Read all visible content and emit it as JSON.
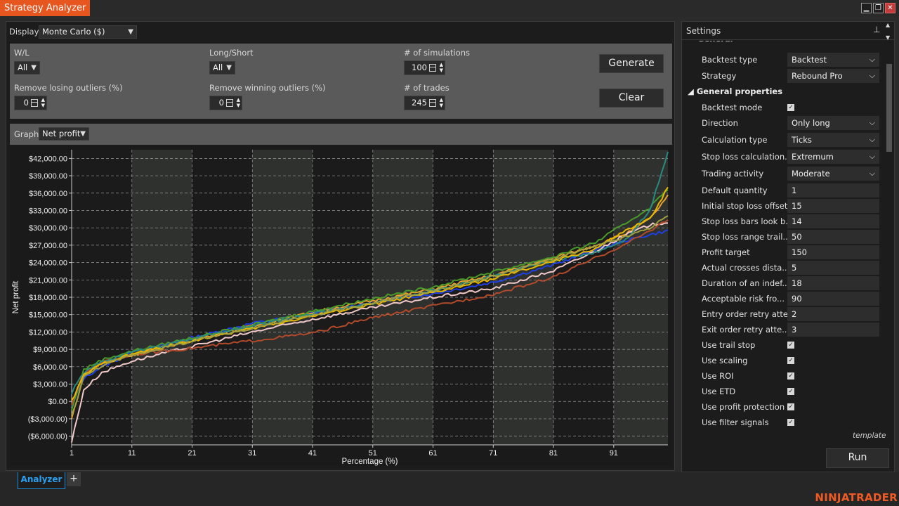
{
  "window": {
    "title": "Strategy Analyzer"
  },
  "toolbar": {
    "display_label": "Display",
    "display_value": "Monte Carlo ($)"
  },
  "filters": {
    "wl_label": "W/L",
    "wl_value": "All",
    "longshort_label": "Long/Short",
    "longshort_value": "All",
    "sims_label": "# of simulations",
    "sims_value": "100",
    "remove_losing_label": "Remove losing outliers (%)",
    "remove_losing_value": "0",
    "remove_winning_label": "Remove winning outliers (%)",
    "remove_winning_value": "0",
    "trades_label": "# of trades",
    "trades_value": "245",
    "generate_label": "Generate",
    "clear_label": "Clear"
  },
  "graph": {
    "label": "Graph",
    "value": "Net profit"
  },
  "chart_data": {
    "type": "line",
    "xlabel": "Percentage (%)",
    "ylabel": "Net profit",
    "xlim": [
      1,
      100
    ],
    "ylim": [
      -7500,
      43500
    ],
    "x_ticks": [
      "1",
      "11",
      "21",
      "31",
      "41",
      "51",
      "61",
      "71",
      "81",
      "91"
    ],
    "y_ticks": [
      "$42,000.00",
      "$39,000.00",
      "$36,000.00",
      "$33,000.00",
      "$30,000.00",
      "$27,000.00",
      "$24,000.00",
      "$21,000.00",
      "$18,000.00",
      "$15,000.00",
      "$12,000.00",
      "$9,000.00",
      "$6,000.00",
      "$3,000.00",
      "$0.00",
      "($3,000.00)",
      "($6,000.00)"
    ],
    "y_tick_values": [
      42000,
      39000,
      36000,
      33000,
      30000,
      27000,
      24000,
      21000,
      18000,
      15000,
      12000,
      9000,
      6000,
      3000,
      0,
      -3000,
      -6000
    ],
    "grid": true,
    "typical_curve": {
      "x": [
        1,
        3,
        6,
        11,
        21,
        31,
        41,
        51,
        61,
        71,
        81,
        88,
        93,
        97,
        100
      ],
      "values": [
        -2000,
        4500,
        6500,
        8000,
        10500,
        12800,
        15000,
        17000,
        19000,
        21500,
        24500,
        26500,
        28500,
        31000,
        34000
      ]
    },
    "series": [
      {
        "color": "#1f3fe0",
        "values": [
          -1000,
          4000,
          6000,
          8300,
          11000,
          13500,
          15200,
          17200,
          18600,
          20600,
          23600,
          26200,
          27800,
          28800,
          29500
        ]
      },
      {
        "color": "#e8a030",
        "values": [
          -3000,
          4500,
          6600,
          8000,
          10600,
          13000,
          15400,
          17400,
          19400,
          21800,
          24800,
          27000,
          29000,
          31500,
          35500
        ]
      },
      {
        "color": "#4a9a2a",
        "values": [
          -1500,
          5500,
          7200,
          8700,
          11000,
          13200,
          15600,
          17800,
          19800,
          22400,
          25000,
          27500,
          30800,
          33500,
          36800
        ]
      },
      {
        "color": "#f0c8c8",
        "values": [
          -7000,
          2000,
          5000,
          7000,
          9500,
          12000,
          14200,
          16200,
          18000,
          19500,
          22600,
          26000,
          28800,
          30500,
          31000
        ]
      },
      {
        "color": "#b04a2a",
        "values": [
          -500,
          4800,
          6800,
          8100,
          9200,
          10500,
          11800,
          14500,
          16500,
          18500,
          21500,
          24800,
          27200,
          29500,
          31500
        ]
      },
      {
        "color": "#2a8a80",
        "values": [
          1500,
          5000,
          6800,
          8500,
          10800,
          13000,
          15200,
          17000,
          19200,
          21700,
          24300,
          25800,
          28000,
          33000,
          43200
        ]
      },
      {
        "color": "#e8b800",
        "values": [
          0,
          4500,
          6500,
          8200,
          10500,
          12600,
          14800,
          16800,
          18800,
          21200,
          24200,
          26400,
          29500,
          31500,
          37000
        ]
      },
      {
        "color": "#a0a040",
        "values": [
          -2500,
          4200,
          6200,
          8000,
          10400,
          12700,
          14900,
          17000,
          19100,
          21600,
          24600,
          26800,
          28400,
          30000,
          32000
        ]
      }
    ]
  },
  "settings": {
    "title": "Settings",
    "truncated_section": "General",
    "section_general_props": "General properties",
    "rows": [
      {
        "name": "Backtest type",
        "value": "Backtest",
        "kind": "combo"
      },
      {
        "name": "Strategy",
        "value": "Rebound Pro",
        "kind": "combo"
      },
      {
        "name": "Backtest mode",
        "value": "",
        "kind": "check"
      },
      {
        "name": "Direction",
        "value": "Only long",
        "kind": "combo"
      },
      {
        "name": "Calculation type",
        "value": "Ticks",
        "kind": "combo"
      },
      {
        "name": "Stop loss calculation...",
        "value": "Extremum",
        "kind": "combo"
      },
      {
        "name": "Trading activity",
        "value": "Moderate",
        "kind": "combo"
      },
      {
        "name": "Default quantity",
        "value": "1",
        "kind": "text"
      },
      {
        "name": "Initial stop loss offset",
        "value": "15",
        "kind": "text"
      },
      {
        "name": "Stop loss bars look b...",
        "value": "14",
        "kind": "text"
      },
      {
        "name": "Stop loss range trail...",
        "value": "50",
        "kind": "text"
      },
      {
        "name": "Profit target",
        "value": "150",
        "kind": "text"
      },
      {
        "name": "Actual crosses dista...",
        "value": "5",
        "kind": "text"
      },
      {
        "name": "Duration of an indef...",
        "value": "18",
        "kind": "text"
      },
      {
        "name": "Acceptable risk fro...",
        "value": "90",
        "kind": "text"
      },
      {
        "name": "Entry order retry atte...",
        "value": "2",
        "kind": "text"
      },
      {
        "name": "Exit order retry atte...",
        "value": "3",
        "kind": "text"
      },
      {
        "name": "Use trail stop",
        "value": "",
        "kind": "check"
      },
      {
        "name": "Use scaling",
        "value": "",
        "kind": "check"
      },
      {
        "name": "Use ROI",
        "value": "",
        "kind": "check"
      },
      {
        "name": "Use ETD",
        "value": "",
        "kind": "check"
      },
      {
        "name": "Use profit protection",
        "value": "",
        "kind": "check"
      },
      {
        "name": "Use filter signals",
        "value": "",
        "kind": "check"
      }
    ],
    "template_label": "template",
    "run_label": "Run"
  },
  "tabs": {
    "active": "Analyzer",
    "add": "+"
  },
  "brand": "NINJATRADER",
  "colors": {
    "accent": "#e8561f",
    "tab_active": "#2aa0f0"
  }
}
